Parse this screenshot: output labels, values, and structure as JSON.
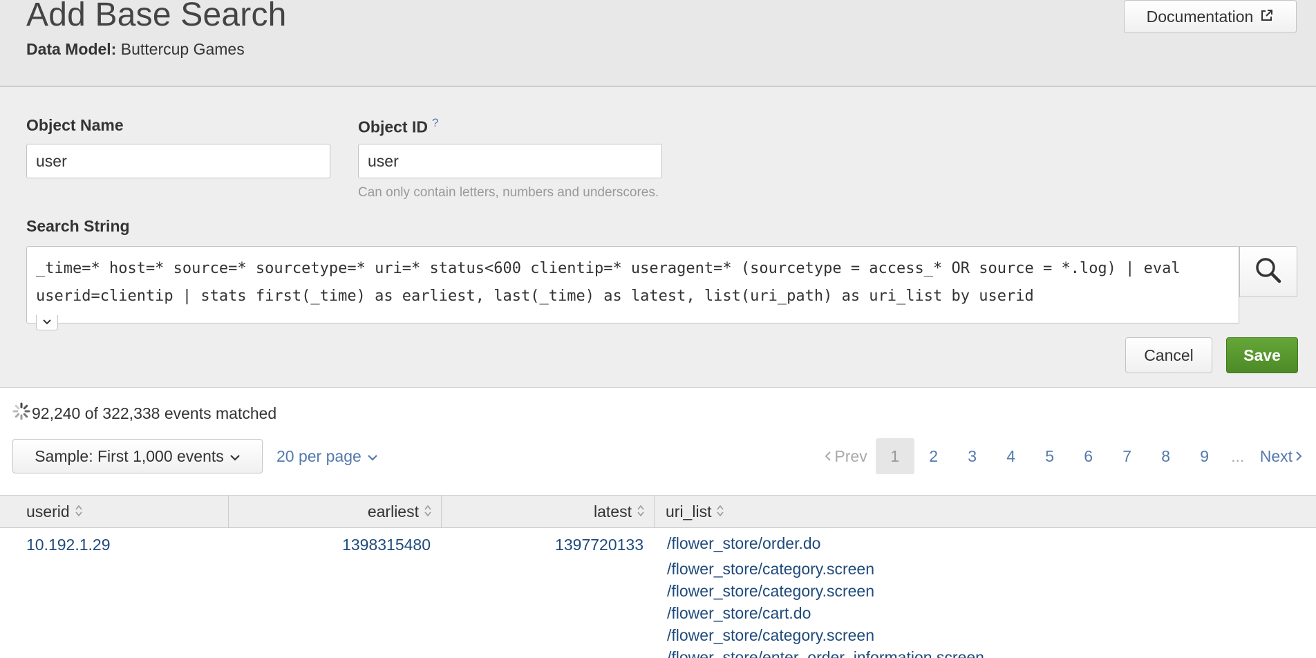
{
  "header": {
    "title": "Add Base Search",
    "data_model_label": "Data Model:",
    "data_model_value": "Buttercup Games",
    "documentation_label": "Documentation"
  },
  "form": {
    "object_name": {
      "label": "Object Name",
      "value": "user"
    },
    "object_id": {
      "label": "Object ID",
      "help": "?",
      "value": "user",
      "hint": "Can only contain letters, numbers and underscores."
    },
    "search_string": {
      "label": "Search String",
      "value": "_time=* host=* source=* sourcetype=* uri=* status<600 clientip=* useragent=* (sourcetype = access_* OR source = *.log) | eval userid=clientip | stats first(_time) as earliest, last(_time) as latest, list(uri_path) as uri_list by userid"
    },
    "cancel_label": "Cancel",
    "save_label": "Save"
  },
  "results": {
    "status_text": "92,240 of 322,338 events matched",
    "sample_label": "Sample: First 1,000 events",
    "per_page_label": "20 per page",
    "pagination": {
      "prev_label": "Prev",
      "pages": [
        "1",
        "2",
        "3",
        "4",
        "5",
        "6",
        "7",
        "8",
        "9"
      ],
      "current": "1",
      "ellipsis": "...",
      "next_label": "Next"
    },
    "columns": [
      "userid",
      "earliest",
      "latest",
      "uri_list"
    ],
    "rows": [
      {
        "userid": "10.192.1.29",
        "earliest": "1398315480",
        "latest": "1397720133",
        "uri_list": [
          "/flower_store/order.do",
          "/flower_store/category.screen",
          "/flower_store/category.screen",
          "/flower_store/cart.do",
          "/flower_store/category.screen",
          "/flower_store/enter_order_information.screen"
        ]
      }
    ]
  },
  "colors": {
    "accent_link": "#5379af",
    "save_green": "#65a637",
    "cell_text": "#1e4a7b"
  },
  "icons": {
    "documentation": "external-link-icon",
    "search": "search-icon",
    "expand": "chevron-down-icon",
    "status": "spinner-icon",
    "sort": "sort-icon"
  }
}
